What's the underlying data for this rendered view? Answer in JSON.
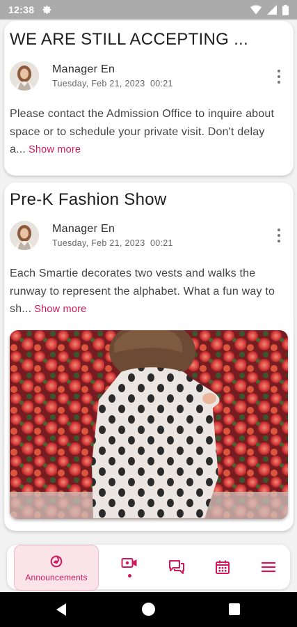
{
  "status_bar": {
    "time": "12:38"
  },
  "posts": [
    {
      "title": "WE ARE STILL ACCEPTING ...",
      "author": "Manager En",
      "date": "Tuesday, Feb 21, 2023",
      "time": "00:21",
      "body": "Please contact the Admission Office to inquire about space or to schedule your private visit. Don't delay a...",
      "show_more": "Show more"
    },
    {
      "title": "Pre-K Fashion Show",
      "author": "Manager En",
      "date": "Tuesday, Feb 21, 2023",
      "time": "00:21",
      "body": "Each Smartie decorates two vests and walks the runway to represent the alphabet. What a fun way to sh...",
      "show_more": "Show more"
    }
  ],
  "nav": {
    "items": [
      {
        "label": "Announcements",
        "icon": "announcements-icon",
        "active": true
      },
      {
        "icon": "video-icon",
        "has_dot": true
      },
      {
        "icon": "chat-icon"
      },
      {
        "icon": "calendar-icon"
      },
      {
        "icon": "menu-icon"
      }
    ]
  },
  "colors": {
    "accent": "#d0175a",
    "active_bg": "#fbe3ea"
  }
}
